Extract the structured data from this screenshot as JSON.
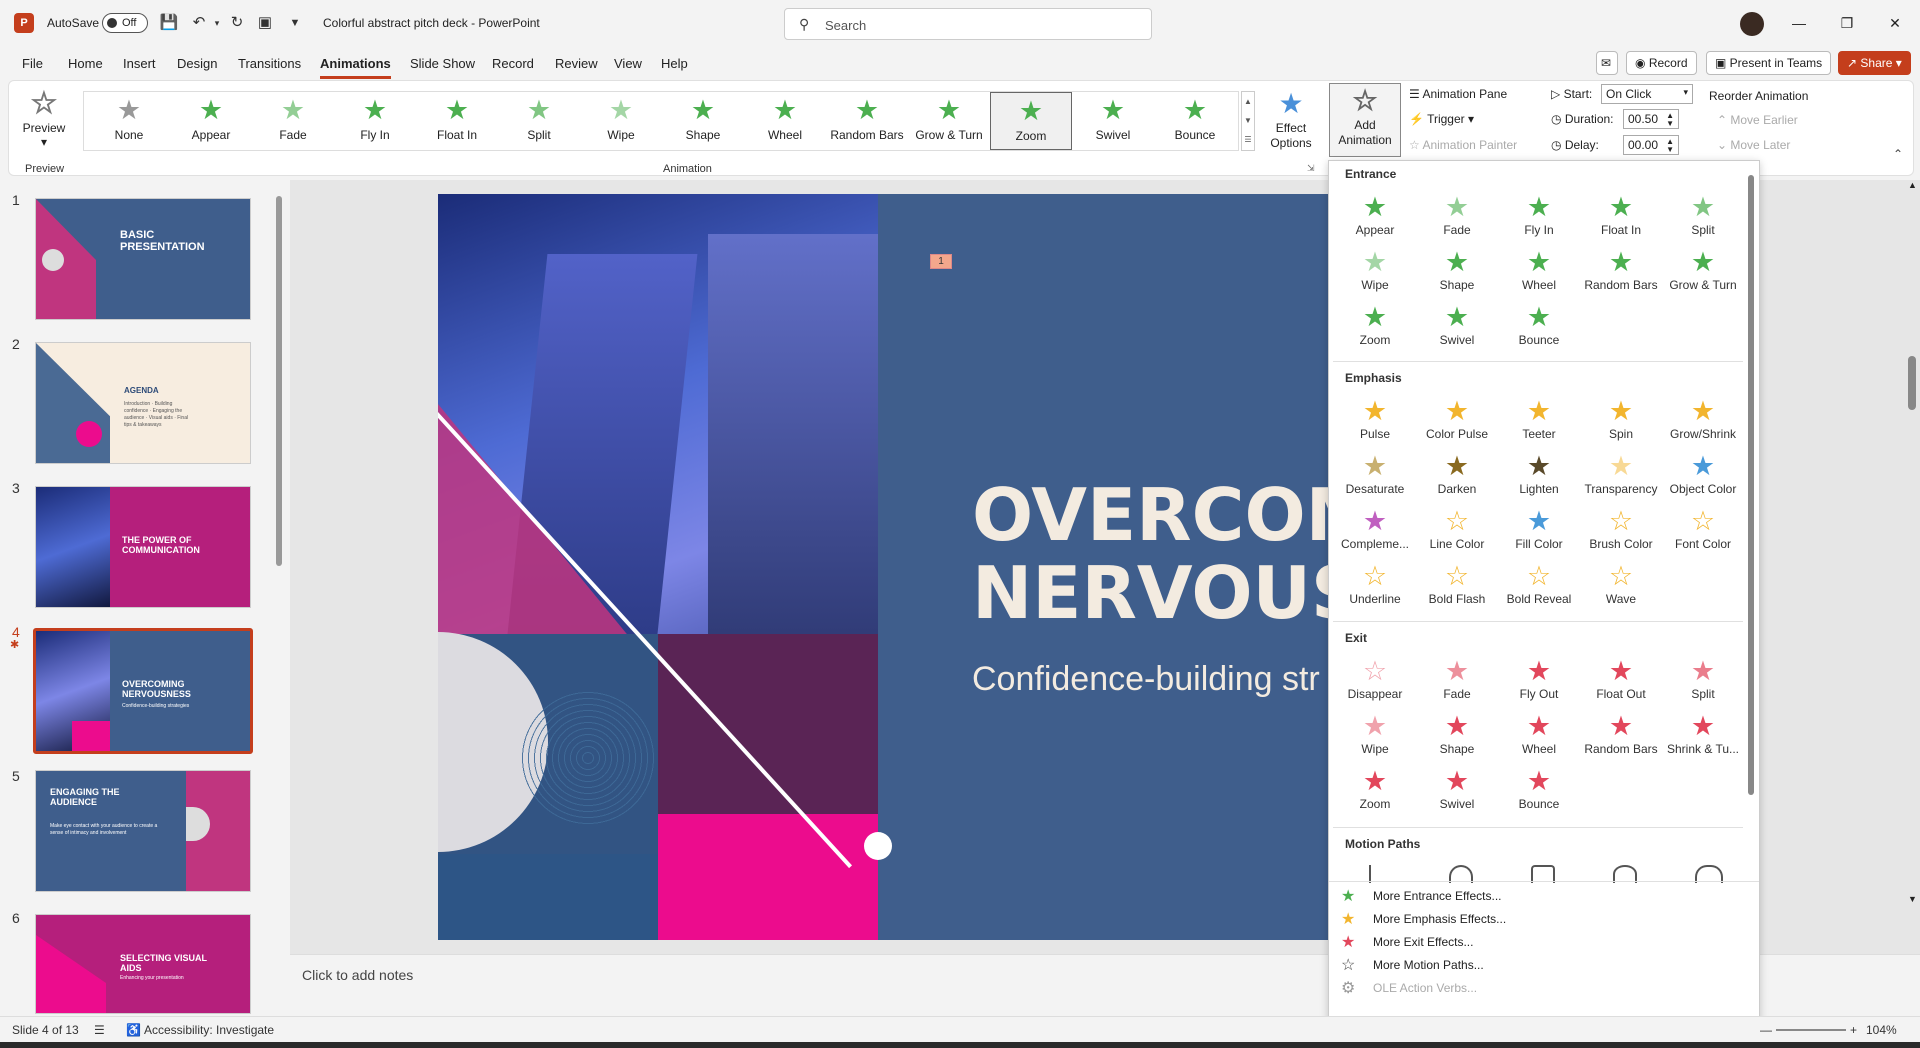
{
  "titlebar": {
    "logo": "P",
    "autosave_label": "AutoSave",
    "autosave_state": "Off",
    "doc_title": "Colorful abstract pitch deck  -  PowerPoint",
    "search_placeholder": "Search"
  },
  "menu": {
    "tabs": [
      "File",
      "Home",
      "Insert",
      "Design",
      "Transitions",
      "Animations",
      "Slide Show",
      "Record",
      "Review",
      "View",
      "Help"
    ],
    "active_tab": "Animations",
    "record_button": "Record",
    "present_button": "Present in Teams",
    "share_button": "Share"
  },
  "ribbon": {
    "preview_label": "Preview",
    "preview_group": "Preview",
    "animation_group": "Animation",
    "gallery": [
      "None",
      "Appear",
      "Fade",
      "Fly In",
      "Float In",
      "Split",
      "Wipe",
      "Shape",
      "Wheel",
      "Random Bars",
      "Grow & Turn",
      "Zoom",
      "Swivel",
      "Bounce"
    ],
    "selected": "Zoom",
    "effect_options": "Effect Options",
    "add_animation": "Add Animation",
    "animation_pane": "Animation Pane",
    "trigger": "Trigger",
    "animation_painter": "Animation Painter",
    "start_label": "Start:",
    "start_value": "On Click",
    "duration_label": "Duration:",
    "duration_value": "00.50",
    "delay_label": "Delay:",
    "delay_value": "00.00",
    "reorder_label": "Reorder Animation",
    "move_earlier": "Move Earlier",
    "move_later": "Move Later"
  },
  "thumbnails": [
    {
      "num": "1",
      "title": "BASIC PRESENTATION",
      "sub": ""
    },
    {
      "num": "2",
      "title": "AGENDA",
      "sub": "Introduction · Building confidence · Engaging the audience · Visual aids · Final tips & takeaways"
    },
    {
      "num": "3",
      "title": "THE POWER OF COMMUNICATION",
      "sub": ""
    },
    {
      "num": "4",
      "title": "OVERCOMING NERVOUSNESS",
      "sub": "Confidence-building strategies"
    },
    {
      "num": "5",
      "title": "ENGAGING THE AUDIENCE",
      "sub": "Make eye contact with your audience to create a sense of intimacy and involvement"
    },
    {
      "num": "6",
      "title": "SELECTING VISUAL AIDS",
      "sub": "Enhancing your presentation"
    }
  ],
  "slide": {
    "anim_tag": "1",
    "title_line1": "OVERCOMI",
    "title_line2": "NERVOUSN",
    "subtitle": "Confidence-building str"
  },
  "notes_placeholder": "Click to add notes",
  "dropdown": {
    "entrance_header": "Entrance",
    "entrance": [
      "Appear",
      "Fade",
      "Fly In",
      "Float In",
      "Split",
      "Wipe",
      "Shape",
      "Wheel",
      "Random Bars",
      "Grow & Turn",
      "Zoom",
      "Swivel",
      "Bounce"
    ],
    "emphasis_header": "Emphasis",
    "emphasis": [
      "Pulse",
      "Color Pulse",
      "Teeter",
      "Spin",
      "Grow/Shrink",
      "Desaturate",
      "Darken",
      "Lighten",
      "Transparency",
      "Object Color",
      "Compleme...",
      "Line Color",
      "Fill Color",
      "Brush Color",
      "Font Color",
      "Underline",
      "Bold Flash",
      "Bold Reveal",
      "Wave"
    ],
    "exit_header": "Exit",
    "exit": [
      "Disappear",
      "Fade",
      "Fly Out",
      "Float Out",
      "Split",
      "Wipe",
      "Shape",
      "Wheel",
      "Random Bars",
      "Shrink & Tu...",
      "Zoom",
      "Swivel",
      "Bounce"
    ],
    "motion_header": "Motion Paths",
    "more_entrance": "More Entrance Effects...",
    "more_emphasis": "More Emphasis Effects...",
    "more_exit": "More Exit Effects...",
    "more_motion": "More Motion Paths...",
    "ole_verbs": "OLE Action Verbs..."
  },
  "status": {
    "slide_of": "Slide 4 of 13",
    "accessibility": "Accessibility: Investigate",
    "zoom": "104%"
  },
  "colors": {
    "accent": "#c43e1c",
    "entrance_star": "#4caf50",
    "emphasis_star": "#f2b52e",
    "exit_star": "#e2475c",
    "slide_bg": "#3f5e8c"
  }
}
